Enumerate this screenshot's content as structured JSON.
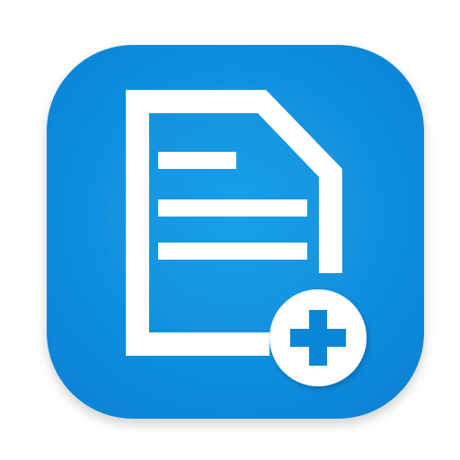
{
  "icon": {
    "name": "new-document-app-icon",
    "glyph": "document-with-plus",
    "colors": {
      "background_center": "#1aa0ea",
      "background_edge": "#0a84d6",
      "foreground": "#ffffff",
      "badge_plus": "#0a86d8"
    }
  }
}
